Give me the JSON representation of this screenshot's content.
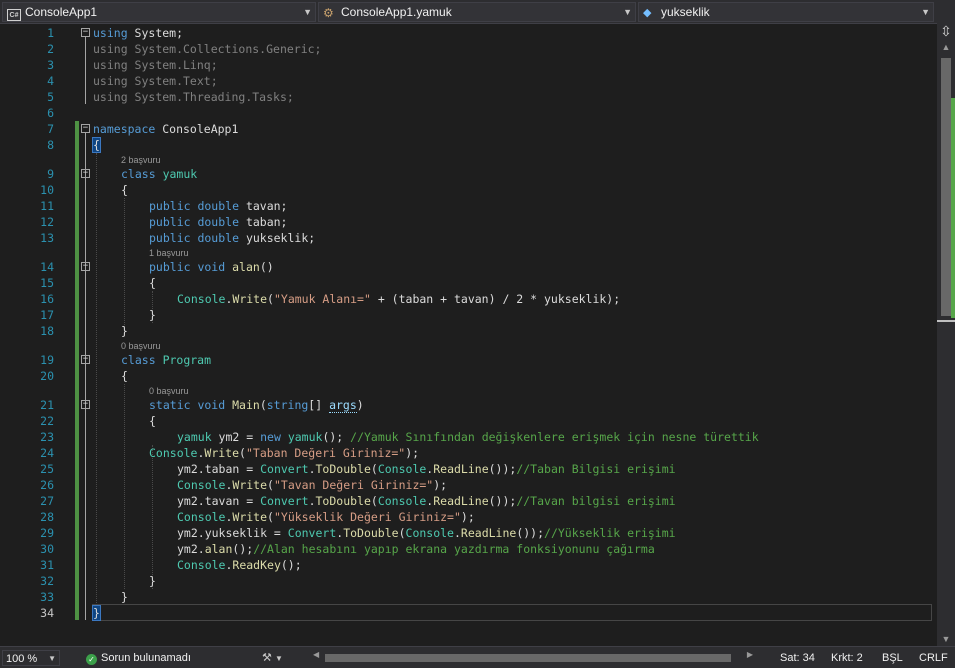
{
  "navbar": {
    "project_combo": {
      "badge": "C#",
      "label": "ConsoleApp1"
    },
    "class_combo": {
      "label": "ConsoleApp1.yamuk"
    },
    "member_combo": {
      "label": "yukseklik"
    },
    "split_glyph": "⇳"
  },
  "line_numbers": [
    "1",
    "2",
    "3",
    "4",
    "5",
    "6",
    "7",
    "8",
    "9",
    "10",
    "11",
    "12",
    "13",
    "14",
    "15",
    "16",
    "17",
    "18",
    "19",
    "20",
    "21",
    "22",
    "23",
    "24",
    "25",
    "26",
    "27",
    "28",
    "29",
    "30",
    "31",
    "32",
    "33",
    "34"
  ],
  "code": {
    "l1": {
      "kw": "using",
      "rest": " System;"
    },
    "l2": {
      "kw": "using",
      "rest": " System.Collections.Generic;"
    },
    "l3": {
      "kw": "using",
      "rest": " System.Linq;"
    },
    "l4": {
      "kw": "using",
      "rest": " System.Text;"
    },
    "l5": {
      "kw": "using",
      "rest": " System.Threading.Tasks;"
    },
    "l7": {
      "kw": "namespace",
      "rest": " ConsoleApp1"
    },
    "l8": {
      "text": "{"
    },
    "lens9": "2 başvuru",
    "l9": {
      "kw": "class",
      "name": "yamuk"
    },
    "l10": {
      "text": "{"
    },
    "l11": {
      "kw": "public double",
      "rest": " tavan;"
    },
    "l12": {
      "kw": "public double",
      "rest": " taban;"
    },
    "l13": {
      "kw": "public double",
      "rest": " yukseklik;"
    },
    "lens14": "1 başvuru",
    "l14": {
      "kw": "public void",
      "name": "alan",
      "rest": "()"
    },
    "l15": {
      "text": "{"
    },
    "l16": {
      "type": "Console",
      "dot": ".",
      "method": "Write",
      "open": "(",
      "str": "\"Yamuk Alanı=\"",
      "rest": " + (taban + tavan) / 2 * yukseklik);"
    },
    "l17": {
      "text": "}"
    },
    "l18": {
      "text": "}"
    },
    "lens19": "0 başvuru",
    "l19": {
      "kw": "class",
      "name": "Program"
    },
    "l20": {
      "text": "{"
    },
    "lens21": "0 başvuru",
    "l21": {
      "kw": "static void",
      "name": "Main",
      "open": "(",
      "kw2": "string",
      "mid": "[] ",
      "param": "args",
      "close": ")"
    },
    "l22": {
      "text": "{"
    },
    "l23": {
      "a": "yamuk",
      "b": " ym2 = ",
      "kw": "new",
      "c": " ",
      "d": "yamuk",
      "e": "(); ",
      "comment": "//Yamuk Sınıfından değişkenlere erişmek için nesne türettik"
    },
    "l24": {
      "type": "Console",
      "dot": ".",
      "method": "Write",
      "open": "(",
      "str": "\"Taban Değeri Giriniz=\"",
      "close": ");"
    },
    "l25": {
      "a": "ym2.taban = ",
      "type": "Convert",
      "dot": ".",
      "method": "ToDouble",
      "open": "(",
      "type2": "Console",
      "dot2": ".",
      "method2": "ReadLine",
      "close": "());",
      "comment": "//Taban Bilgisi erişimi"
    },
    "l26": {
      "type": "Console",
      "dot": ".",
      "method": "Write",
      "open": "(",
      "str": "\"Tavan Değeri Giriniz=\"",
      "close": ");"
    },
    "l27": {
      "a": "ym2.tavan = ",
      "type": "Convert",
      "dot": ".",
      "method": "ToDouble",
      "open": "(",
      "type2": "Console",
      "dot2": ".",
      "method2": "ReadLine",
      "close": "());",
      "comment": "//Tavan bilgisi erişimi"
    },
    "l28": {
      "type": "Console",
      "dot": ".",
      "method": "Write",
      "open": "(",
      "str": "\"Yükseklik Değeri Giriniz=\"",
      "close": ");"
    },
    "l29": {
      "a": "ym2.yukseklik = ",
      "type": "Convert",
      "dot": ".",
      "method": "ToDouble",
      "open": "(",
      "type2": "Console",
      "dot2": ".",
      "method2": "ReadLine",
      "close": "());",
      "comment": "//Yükseklik erişimi"
    },
    "l30": {
      "a": "ym2.",
      "method": "alan",
      "close": "();",
      "comment": "//Alan hesabını yapıp ekrana yazdırma fonksiyonunu çağırma"
    },
    "l31": {
      "type": "Console",
      "dot": ".",
      "method": "ReadKey",
      "close": "();"
    },
    "l32": {
      "text": "}"
    },
    "l33": {
      "text": "}"
    },
    "l34": {
      "text": "}"
    }
  },
  "colors": {
    "keyword": "#569cd6",
    "type": "#4ec9b0",
    "string": "#d69d85",
    "comment": "#57a64a",
    "method": "#dcdcaa",
    "line_number": "#2b91af",
    "change_bar": "#57a64a"
  },
  "statusbar": {
    "zoom": "100 %",
    "issues": "Sorun bulunamadı",
    "ok_icon": "✓",
    "brush_icon": "⚒",
    "line": "Sat: 34",
    "col": "Krkt: 2",
    "insert_mode": "BŞL",
    "line_ending": "CRLF"
  }
}
